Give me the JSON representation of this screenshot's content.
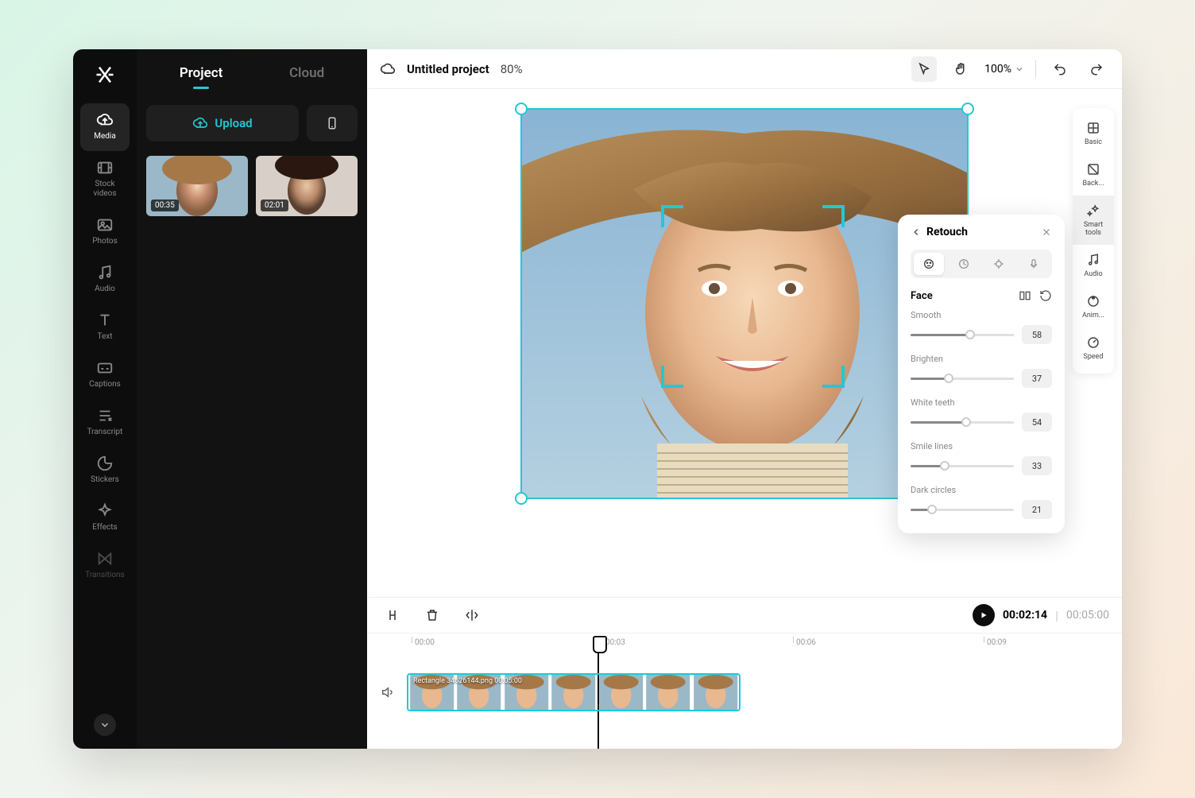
{
  "sidebar": {
    "items": [
      {
        "label": "Media"
      },
      {
        "label": "Stock\nvideos"
      },
      {
        "label": "Photos"
      },
      {
        "label": "Audio"
      },
      {
        "label": "Text"
      },
      {
        "label": "Captions"
      },
      {
        "label": "Transcript"
      },
      {
        "label": "Stickers"
      },
      {
        "label": "Effects"
      },
      {
        "label": "Transitions"
      }
    ]
  },
  "panel": {
    "tabs": [
      {
        "label": "Project"
      },
      {
        "label": "Cloud"
      }
    ],
    "upload_label": "Upload",
    "thumbs": [
      {
        "duration": "00:35"
      },
      {
        "duration": "02:01"
      }
    ]
  },
  "topbar": {
    "title": "Untitled project",
    "percent": "80%",
    "zoom": "100%"
  },
  "right_rail": [
    {
      "label": "Basic"
    },
    {
      "label": "Back..."
    },
    {
      "label": "Smart\ntools"
    },
    {
      "label": "Audio"
    },
    {
      "label": "Anim..."
    },
    {
      "label": "Speed"
    }
  ],
  "retouch": {
    "title": "Retouch",
    "section": "Face",
    "sliders": [
      {
        "label": "Smooth",
        "value": 58
      },
      {
        "label": "Brighten",
        "value": 37
      },
      {
        "label": "White teeth",
        "value": 54
      },
      {
        "label": "Smile lines",
        "value": 33
      },
      {
        "label": "Dark circles",
        "value": 21
      }
    ]
  },
  "timeline": {
    "current": "00:02:14",
    "duration": "00:05:00",
    "ticks": [
      "00:00",
      "00:03",
      "00:06",
      "00:09"
    ],
    "clip_label": "Rectangle 34626144.png    00:05:00"
  }
}
